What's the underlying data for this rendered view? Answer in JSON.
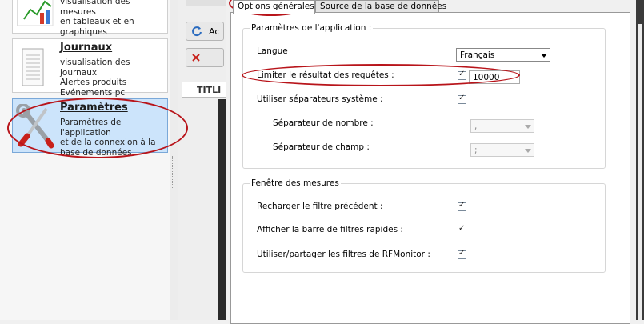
{
  "nav": {
    "mesures": {
      "desc": "visualisation des mesures\nen tableaux et en\ngraphiques"
    },
    "journaux": {
      "title": "Journaux",
      "desc": "visualisation des journaux\nAlertes produits\nEvénements pc"
    },
    "parametres": {
      "title": "Paramètres",
      "desc": "Paramètres de l'application\net de la connexion à la\nbase de données"
    }
  },
  "middle": {
    "btn1": "Ac",
    "title": "TITLI"
  },
  "dialog": {
    "tabs": [
      {
        "label": "Options générales",
        "active": true
      },
      {
        "label": "Source de la base de données",
        "active": false
      }
    ],
    "group_app": {
      "label": "Paramètres de l'application :",
      "langue_label": "Langue",
      "langue_value": "Français",
      "limit_label": "Limiter le résultat des requêtes :",
      "limit_checked": true,
      "limit_value": "10000",
      "sep_sys_label": "Utiliser séparateurs système :",
      "sep_sys_checked": true,
      "sep_num_label": "Séparateur de nombre :",
      "sep_num_value": ",",
      "sep_champ_label": "Séparateur de champ :",
      "sep_champ_value": ";"
    },
    "group_mes": {
      "label": "Fenêtre des mesures",
      "items": [
        {
          "label": "Recharger le filtre précédent :",
          "checked": true
        },
        {
          "label": "Afficher la barre de filtres rapides :",
          "checked": true
        },
        {
          "label": "Utiliser/partager les filtres de RFMonitor :",
          "checked": true
        }
      ]
    }
  },
  "colors": {
    "selected_nav": "#cce4fb",
    "annotation": "#b8141a"
  }
}
